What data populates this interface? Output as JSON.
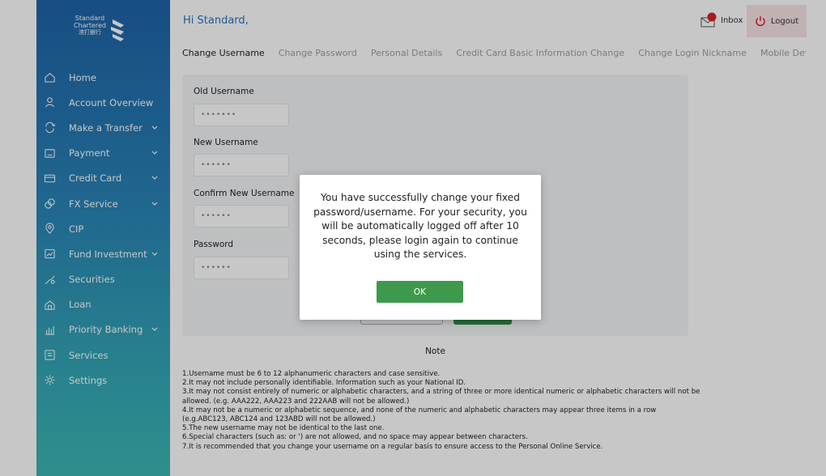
{
  "brand": {
    "name_line1": "Standard",
    "name_line2": "Chartered",
    "name_chinese": "渣打銀行",
    "colors": {
      "sidebar_top": "#1f63a8",
      "sidebar_bottom": "#3db7b3",
      "ok_button": "#3d9a4c",
      "link": "#2a73c0"
    }
  },
  "header": {
    "greeting": "Hi Standard,",
    "inbox_label": "Inbox",
    "inbox_icon": "mail-notification-icon",
    "logout_label": "Logout",
    "logout_icon": "power-icon"
  },
  "sidebar": {
    "items": [
      {
        "label": "Home",
        "icon": "home-icon",
        "has_submenu": false
      },
      {
        "label": "Account Overview",
        "icon": "user-icon",
        "has_submenu": false
      },
      {
        "label": "Make a Transfer",
        "icon": "transfer-icon",
        "has_submenu": true
      },
      {
        "label": "Payment",
        "icon": "payment-icon",
        "has_submenu": true
      },
      {
        "label": "Credit Card",
        "icon": "credit-card-icon",
        "has_submenu": true
      },
      {
        "label": "FX Service",
        "icon": "fx-icon",
        "has_submenu": true
      },
      {
        "label": "CIP",
        "icon": "cip-icon",
        "has_submenu": false
      },
      {
        "label": "Fund Investment",
        "icon": "chart-icon",
        "has_submenu": true
      },
      {
        "label": "Securities",
        "icon": "securities-icon",
        "has_submenu": false
      },
      {
        "label": "Loan",
        "icon": "loan-icon",
        "has_submenu": false
      },
      {
        "label": "Priority Banking",
        "icon": "priority-icon",
        "has_submenu": true
      },
      {
        "label": "Services",
        "icon": "services-icon",
        "has_submenu": false
      },
      {
        "label": "Settings",
        "icon": "gear-icon",
        "has_submenu": false
      }
    ]
  },
  "tabs": [
    {
      "label": "Change Username",
      "active": true
    },
    {
      "label": "Change Password",
      "active": false
    },
    {
      "label": "Personal Details",
      "active": false
    },
    {
      "label": "Credit Card Basic Information Change",
      "active": false
    },
    {
      "label": "Change Login Nickname",
      "active": false
    },
    {
      "label": "Mobile Device Ver",
      "active": false
    }
  ],
  "form": {
    "old_username": {
      "label": "Old Username",
      "value": "•••••••"
    },
    "new_username": {
      "label": "New Username",
      "value": "••••••"
    },
    "confirm_username": {
      "label": "Confirm New Username",
      "value": "••••••"
    },
    "password": {
      "label": "Password",
      "value": "••••••"
    }
  },
  "note": {
    "title": "Note",
    "rules": [
      "1.Username must be 6 to 12 alphanumeric characters and case sensitive.",
      "2.It may not include personally identifiable. Information such as your National ID.",
      "3.It may not consist entirely of numeric or alphabetic characters, and a string of three or more identical numeric or alphabetic characters will not be allowed. (e.g. AAA222, AAA223 and 222AAB will not be allowed.)",
      "4.It may not be a numeric or alphabetic sequence, and none of the numeric and alphabetic characters may appear three items in a row (e.g.ABC123, ABC124 and 123ABD will not be allowed.)",
      "5.The new username may not be identical to the last one.",
      "6.Special characters (such as: or   ') are not allowed, and no space may appear between characters.",
      "7.It is recommended that you change your username on a regular basis to ensure access to the Personal Online Service."
    ]
  },
  "modal": {
    "message": "You have successfully change your fixed password/username. For your security, you will be automatically logged off after 10 seconds, please login again to continue using the services.",
    "ok_label": "OK"
  }
}
